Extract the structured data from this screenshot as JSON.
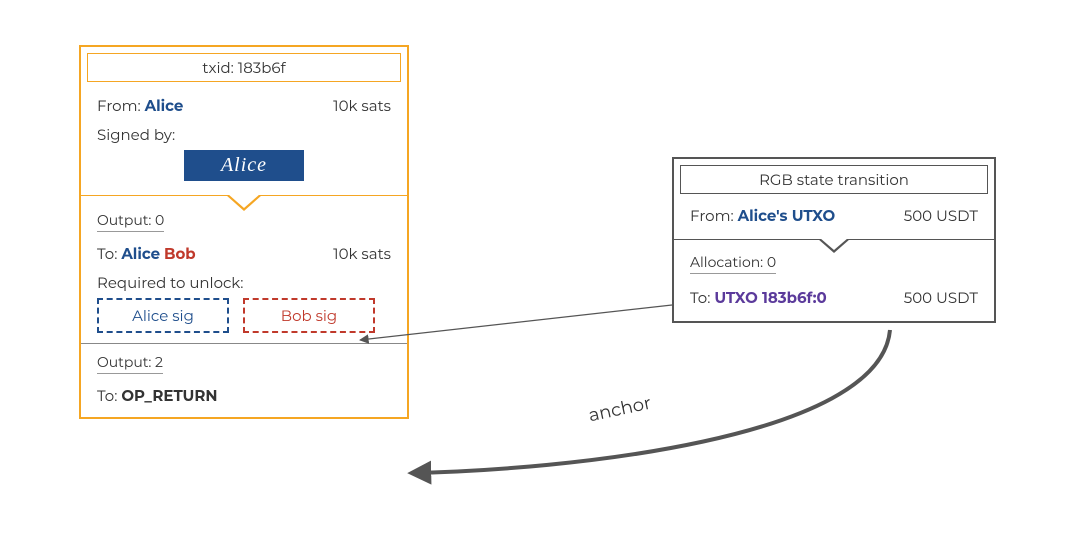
{
  "tx": {
    "txid_label": "txid: 183b6f",
    "from_label": "From:",
    "from_name": "Alice",
    "input_amount": "10k sats",
    "signed_by_label": "Signed by:",
    "signature_plate": "Alice",
    "outputs": [
      {
        "title": "Output: 0",
        "to_label": "To:",
        "to_alice": "Alice",
        "to_bob": "Bob",
        "amount": "10k sats",
        "required_label": "Required to unlock:",
        "sig_alice": "Alice sig",
        "sig_bob": "Bob sig"
      },
      {
        "title": "Output: 2",
        "to_label": "To:",
        "to_target": "OP_RETURN"
      }
    ]
  },
  "rgb": {
    "header": "RGB state transition",
    "from_label": "From:",
    "from_name": "Alice's UTXO",
    "from_amount": "500 USDT",
    "alloc_title": "Allocation: 0",
    "to_label": "To:",
    "to_utxo": "UTXO 183b6f:0",
    "to_amount": "500 USDT"
  },
  "anchor_text": "anchor"
}
